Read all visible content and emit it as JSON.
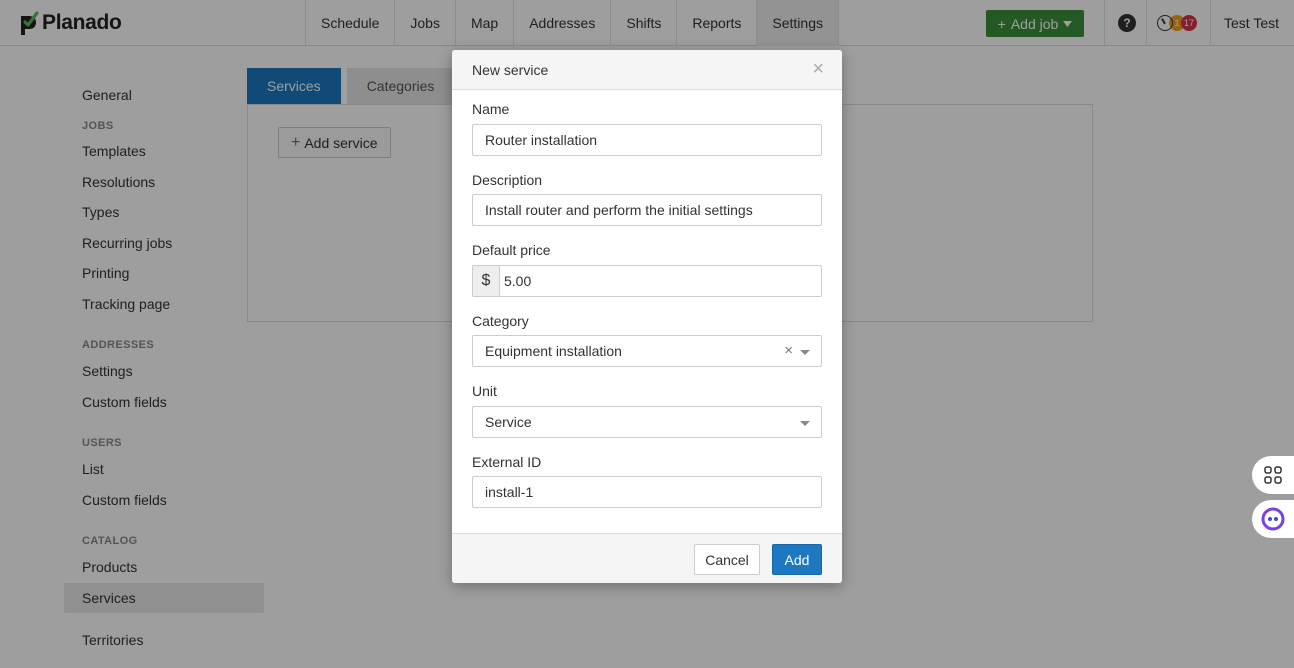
{
  "app": {
    "logo_text": "Planado"
  },
  "nav": {
    "items": [
      "Schedule",
      "Jobs",
      "Map",
      "Addresses",
      "Shifts",
      "Reports",
      "Settings"
    ],
    "add_job_label": "Add job",
    "help_label": "?",
    "notif_badge_1": "1",
    "notif_badge_2": "17",
    "user_name": "Test Test"
  },
  "sidebar": {
    "general": "General",
    "jobs_heading": "JOBS",
    "jobs": [
      "Templates",
      "Resolutions",
      "Types",
      "Recurring jobs",
      "Printing",
      "Tracking page"
    ],
    "addresses_heading": "ADDRESSES",
    "addresses": [
      "Settings",
      "Custom fields"
    ],
    "users_heading": "USERS",
    "users": [
      "List",
      "Custom fields"
    ],
    "catalog_heading": "CATALOG",
    "catalog": [
      "Products",
      "Services"
    ],
    "territories": "Territories"
  },
  "main": {
    "tabs": [
      "Services",
      "Categories"
    ],
    "add_service_label": "Add service"
  },
  "modal": {
    "title": "New service",
    "name_label": "Name",
    "name_value": "Router installation",
    "description_label": "Description",
    "description_value": "Install router and perform the initial settings",
    "price_label": "Default price",
    "currency": "$",
    "price_value": "5.00",
    "category_label": "Category",
    "category_value": "Equipment installation",
    "unit_label": "Unit",
    "unit_value": "Service",
    "external_id_label": "External ID",
    "external_id_value": "install-1",
    "cancel_label": "Cancel",
    "add_label": "Add"
  },
  "colors": {
    "brand_green": "#3a8f3a",
    "primary_blue": "#1d78c1"
  }
}
